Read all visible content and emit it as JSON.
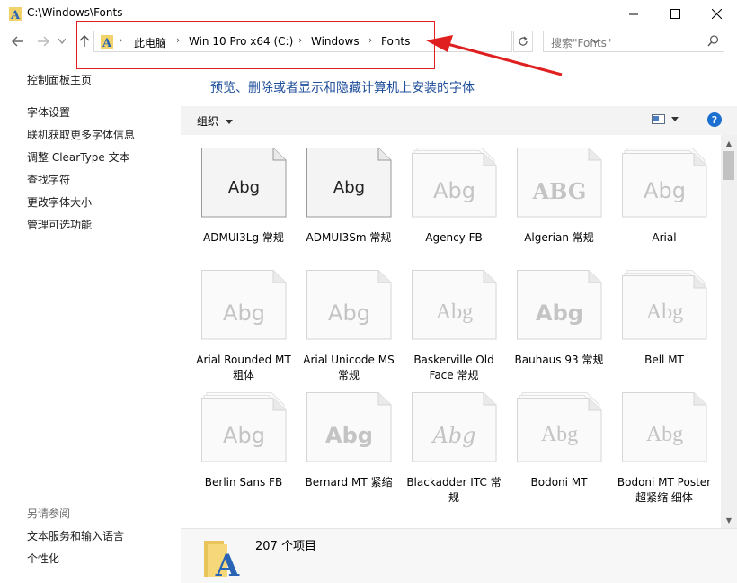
{
  "window": {
    "title": "C:\\Windows\\Fonts"
  },
  "address": {
    "crumbs": [
      "此电脑",
      "Win 10 Pro x64 (C:)",
      "Windows",
      "Fonts"
    ]
  },
  "search": {
    "placeholder": "搜索\"Fonts\""
  },
  "sidebar": {
    "links": [
      "控制面板主页",
      "字体设置",
      "联机获取更多字体信息",
      "调整 ClearType 文本",
      "查找字符",
      "更改字体大小",
      "管理可选功能"
    ],
    "see_also_heading": "另请参阅",
    "see_also": [
      "文本服务和输入语言",
      "个性化"
    ]
  },
  "main": {
    "title": "预览、删除或者显示和隐藏计算机上安装的字体"
  },
  "toolbar": {
    "organize": "组织"
  },
  "fonts": [
    {
      "name": "ADMUI3Lg 常规",
      "sample": "Abg",
      "style": "dark"
    },
    {
      "name": "ADMUI3Sm 常规",
      "sample": "Abg",
      "style": "dark"
    },
    {
      "name": "Agency FB",
      "sample": "Abg",
      "style": "light-stack"
    },
    {
      "name": "Algerian 常规",
      "sample": "ABG",
      "style": "light"
    },
    {
      "name": "Arial",
      "sample": "Abg",
      "style": "light-stack"
    },
    {
      "name": "Arial Rounded MT 粗体",
      "sample": "Abg",
      "style": "light"
    },
    {
      "name": "Arial Unicode MS 常规",
      "sample": "Abg",
      "style": "light"
    },
    {
      "name": "Baskerville Old Face 常规",
      "sample": "Abg",
      "style": "light"
    },
    {
      "name": "Bauhaus 93 常规",
      "sample": "Abg",
      "style": "light"
    },
    {
      "name": "Bell MT",
      "sample": "Abg",
      "style": "light-stack"
    },
    {
      "name": "Berlin Sans FB",
      "sample": "Abg",
      "style": "light-stack"
    },
    {
      "name": "Bernard MT 紧缩",
      "sample": "Abg",
      "style": "light"
    },
    {
      "name": "Blackadder ITC 常规",
      "sample": "Abg",
      "style": "light"
    },
    {
      "name": "Bodoni MT",
      "sample": "Abg",
      "style": "light-stack"
    },
    {
      "name": "Bodoni MT Poster 超紧缩 细体",
      "sample": "Abg",
      "style": "light"
    }
  ],
  "status": {
    "count": "207 个项目"
  },
  "colors": {
    "accent": "#1e4e9a",
    "highlight": "#e02020",
    "help": "#1a6fd0"
  }
}
